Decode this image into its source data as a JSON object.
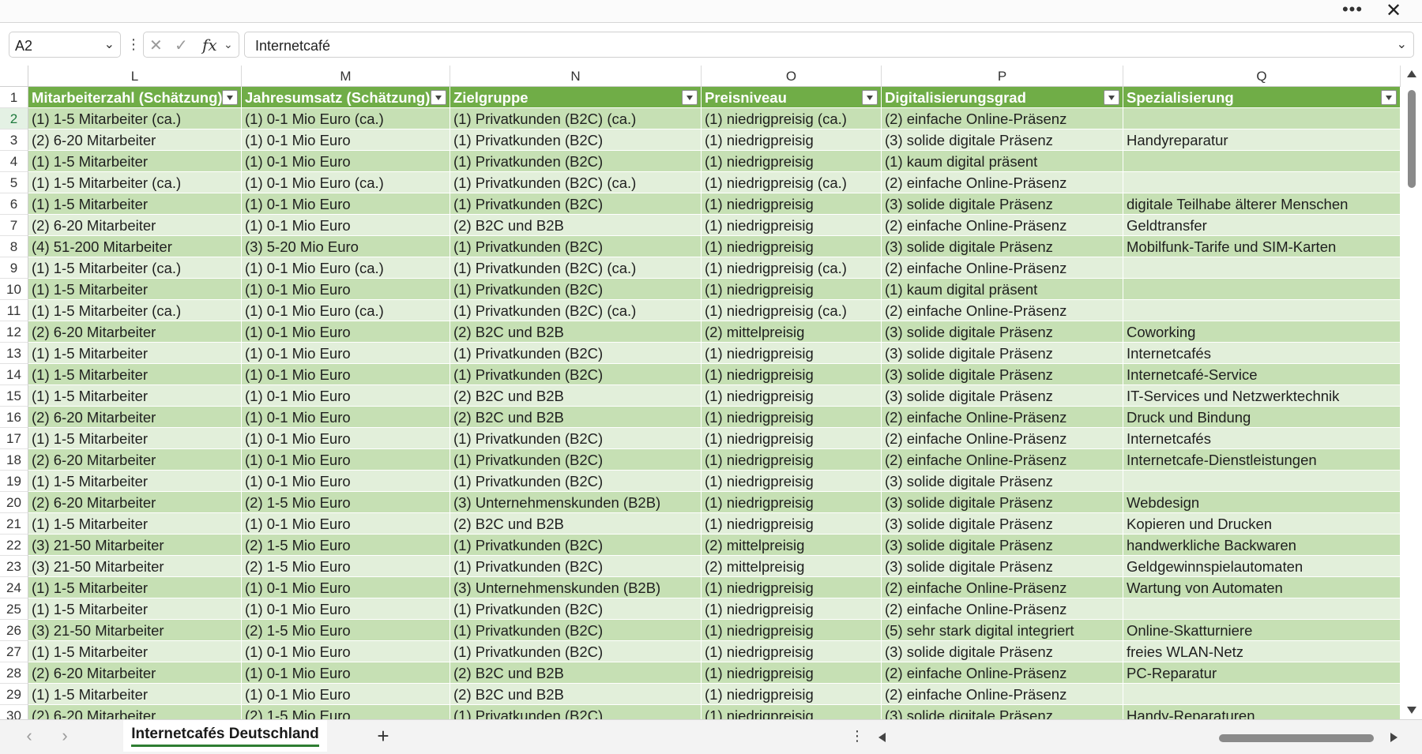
{
  "window": {
    "more_icon": "more-horizontal-icon",
    "close_icon": "close-icon"
  },
  "formula_bar": {
    "name_box": "A2",
    "formula_value": "Internetcafé"
  },
  "columns": [
    "L",
    "M",
    "N",
    "O",
    "P",
    "Q"
  ],
  "header_row_number": "1",
  "headers": [
    "Mitarbeiterzahl (Schätzung)",
    "Jahresumsatz (Schätzung)",
    "Zielgruppe",
    "Preisniveau",
    "Digitalisierungsgrad",
    "Spezialisierung"
  ],
  "rows": [
    {
      "n": "2",
      "cells": [
        "(1) 1-5 Mitarbeiter (ca.)",
        "(1) 0-1 Mio Euro (ca.)",
        "(1) Privatkunden (B2C) (ca.)",
        "(1) niedrigpreisig (ca.)",
        "(2) einfache Online-Präsenz",
        ""
      ]
    },
    {
      "n": "3",
      "cells": [
        "(2) 6-20 Mitarbeiter",
        "(1) 0-1 Mio Euro",
        "(1) Privatkunden (B2C)",
        "(1) niedrigpreisig",
        "(3) solide digitale Präsenz",
        "Handyreparatur"
      ]
    },
    {
      "n": "4",
      "cells": [
        "(1) 1-5 Mitarbeiter",
        "(1) 0-1 Mio Euro",
        "(1) Privatkunden (B2C)",
        "(1) niedrigpreisig",
        "(1) kaum digital präsent",
        ""
      ]
    },
    {
      "n": "5",
      "cells": [
        "(1) 1-5 Mitarbeiter (ca.)",
        "(1) 0-1 Mio Euro (ca.)",
        "(1) Privatkunden (B2C) (ca.)",
        "(1) niedrigpreisig (ca.)",
        "(2) einfache Online-Präsenz",
        ""
      ]
    },
    {
      "n": "6",
      "cells": [
        "(1) 1-5 Mitarbeiter",
        "(1) 0-1 Mio Euro",
        "(1) Privatkunden (B2C)",
        "(1) niedrigpreisig",
        "(3) solide digitale Präsenz",
        "digitale Teilhabe älterer Menschen"
      ]
    },
    {
      "n": "7",
      "cells": [
        "(2) 6-20 Mitarbeiter",
        "(1) 0-1 Mio Euro",
        "(2) B2C und B2B",
        "(1) niedrigpreisig",
        "(2) einfache Online-Präsenz",
        "Geldtransfer"
      ]
    },
    {
      "n": "8",
      "cells": [
        "(4) 51-200 Mitarbeiter",
        "(3) 5-20 Mio Euro",
        "(1) Privatkunden (B2C)",
        "(1) niedrigpreisig",
        "(3) solide digitale Präsenz",
        "Mobilfunk-Tarife und SIM-Karten"
      ]
    },
    {
      "n": "9",
      "cells": [
        "(1) 1-5 Mitarbeiter (ca.)",
        "(1) 0-1 Mio Euro (ca.)",
        "(1) Privatkunden (B2C) (ca.)",
        "(1) niedrigpreisig (ca.)",
        "(2) einfache Online-Präsenz",
        ""
      ]
    },
    {
      "n": "10",
      "cells": [
        "(1) 1-5 Mitarbeiter",
        "(1) 0-1 Mio Euro",
        "(1) Privatkunden (B2C)",
        "(1) niedrigpreisig",
        "(1) kaum digital präsent",
        ""
      ]
    },
    {
      "n": "11",
      "cells": [
        "(1) 1-5 Mitarbeiter (ca.)",
        "(1) 0-1 Mio Euro (ca.)",
        "(1) Privatkunden (B2C) (ca.)",
        "(1) niedrigpreisig (ca.)",
        "(2) einfache Online-Präsenz",
        ""
      ]
    },
    {
      "n": "12",
      "cells": [
        "(2) 6-20 Mitarbeiter",
        "(1) 0-1 Mio Euro",
        "(2) B2C und B2B",
        "(2) mittelpreisig",
        "(3) solide digitale Präsenz",
        "Coworking"
      ]
    },
    {
      "n": "13",
      "cells": [
        "(1) 1-5 Mitarbeiter",
        "(1) 0-1 Mio Euro",
        "(1) Privatkunden (B2C)",
        "(1) niedrigpreisig",
        "(3) solide digitale Präsenz",
        "Internetcafés"
      ]
    },
    {
      "n": "14",
      "cells": [
        "(1) 1-5 Mitarbeiter",
        "(1) 0-1 Mio Euro",
        "(1) Privatkunden (B2C)",
        "(1) niedrigpreisig",
        "(3) solide digitale Präsenz",
        "Internetcafé-Service"
      ]
    },
    {
      "n": "15",
      "cells": [
        "(1) 1-5 Mitarbeiter",
        "(1) 0-1 Mio Euro",
        "(2) B2C und B2B",
        "(1) niedrigpreisig",
        "(3) solide digitale Präsenz",
        "IT-Services und Netzwerktechnik"
      ]
    },
    {
      "n": "16",
      "cells": [
        "(2) 6-20 Mitarbeiter",
        "(1) 0-1 Mio Euro",
        "(2) B2C und B2B",
        "(1) niedrigpreisig",
        "(2) einfache Online-Präsenz",
        "Druck und Bindung"
      ]
    },
    {
      "n": "17",
      "cells": [
        "(1) 1-5 Mitarbeiter",
        "(1) 0-1 Mio Euro",
        "(1) Privatkunden (B2C)",
        "(1) niedrigpreisig",
        "(2) einfache Online-Präsenz",
        "Internetcafés"
      ]
    },
    {
      "n": "18",
      "cells": [
        "(2) 6-20 Mitarbeiter",
        "(1) 0-1 Mio Euro",
        "(1) Privatkunden (B2C)",
        "(1) niedrigpreisig",
        "(2) einfache Online-Präsenz",
        "Internetcafe-Dienstleistungen"
      ]
    },
    {
      "n": "19",
      "cells": [
        "(1) 1-5 Mitarbeiter",
        "(1) 0-1 Mio Euro",
        "(1) Privatkunden (B2C)",
        "(1) niedrigpreisig",
        "(3) solide digitale Präsenz",
        ""
      ]
    },
    {
      "n": "20",
      "cells": [
        "(2) 6-20 Mitarbeiter",
        "(2) 1-5 Mio Euro",
        "(3) Unternehmenskunden (B2B)",
        "(1) niedrigpreisig",
        "(3) solide digitale Präsenz",
        "Webdesign"
      ]
    },
    {
      "n": "21",
      "cells": [
        "(1) 1-5 Mitarbeiter",
        "(1) 0-1 Mio Euro",
        "(2) B2C und B2B",
        "(1) niedrigpreisig",
        "(3) solide digitale Präsenz",
        "Kopieren und Drucken"
      ]
    },
    {
      "n": "22",
      "cells": [
        "(3) 21-50 Mitarbeiter",
        "(2) 1-5 Mio Euro",
        "(1) Privatkunden (B2C)",
        "(2) mittelpreisig",
        "(3) solide digitale Präsenz",
        "handwerkliche Backwaren"
      ]
    },
    {
      "n": "23",
      "cells": [
        "(3) 21-50 Mitarbeiter",
        "(2) 1-5 Mio Euro",
        "(1) Privatkunden (B2C)",
        "(2) mittelpreisig",
        "(3) solide digitale Präsenz",
        "Geldgewinnspielautomaten"
      ]
    },
    {
      "n": "24",
      "cells": [
        "(1) 1-5 Mitarbeiter",
        "(1) 0-1 Mio Euro",
        "(3) Unternehmenskunden (B2B)",
        "(1) niedrigpreisig",
        "(2) einfache Online-Präsenz",
        "Wartung von Automaten"
      ]
    },
    {
      "n": "25",
      "cells": [
        "(1) 1-5 Mitarbeiter",
        "(1) 0-1 Mio Euro",
        "(1) Privatkunden (B2C)",
        "(1) niedrigpreisig",
        "(2) einfache Online-Präsenz",
        ""
      ]
    },
    {
      "n": "26",
      "cells": [
        "(3) 21-50 Mitarbeiter",
        "(2) 1-5 Mio Euro",
        "(1) Privatkunden (B2C)",
        "(1) niedrigpreisig",
        "(5) sehr stark digital integriert",
        "Online-Skatturniere"
      ]
    },
    {
      "n": "27",
      "cells": [
        "(1) 1-5 Mitarbeiter",
        "(1) 0-1 Mio Euro",
        "(1) Privatkunden (B2C)",
        "(1) niedrigpreisig",
        "(3) solide digitale Präsenz",
        "freies WLAN-Netz"
      ]
    },
    {
      "n": "28",
      "cells": [
        "(2) 6-20 Mitarbeiter",
        "(1) 0-1 Mio Euro",
        "(2) B2C und B2B",
        "(1) niedrigpreisig",
        "(2) einfache Online-Präsenz",
        "PC-Reparatur"
      ]
    },
    {
      "n": "29",
      "cells": [
        "(1) 1-5 Mitarbeiter",
        "(1) 0-1 Mio Euro",
        "(2) B2C und B2B",
        "(1) niedrigpreisig",
        "(2) einfache Online-Präsenz",
        ""
      ]
    },
    {
      "n": "30",
      "cells": [
        "(2) 6-20 Mitarbeiter",
        "(2) 1-5 Mio Euro",
        "(1) Privatkunden (B2C)",
        "(1) niedrigpreisig",
        "(3) solide digitale Präsenz",
        "Handy-Reparaturen"
      ]
    }
  ],
  "selected_row": "2",
  "sheet_tab": "Internetcafés Deutschland",
  "colors": {
    "header_green": "#70ad47",
    "band_dark": "#c6e0b4",
    "band_light": "#e2efda",
    "accent": "#2e7d32"
  }
}
